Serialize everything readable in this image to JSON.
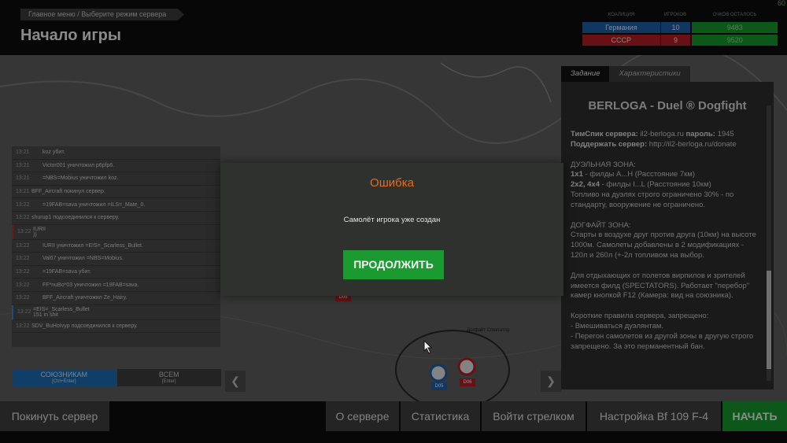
{
  "fps": "60",
  "breadcrumb": "Главное меню  / Выберите режим сервера",
  "page_title": "Начало игры",
  "scoreboard": {
    "headers": [
      "КОАЛИЦИЯ",
      "ИГРОКОВ",
      "ОЧКОВ ОСТАЛОСЬ"
    ],
    "rows": [
      {
        "coalition": "Германия",
        "players": "10",
        "points": "9483"
      },
      {
        "coalition": "СССР",
        "players": "9",
        "points": "9520"
      }
    ]
  },
  "chat": {
    "lines": [
      {
        "time": "13:21",
        "text": "koz убит."
      },
      {
        "time": "13:21",
        "text": "Victor001 уничтожил p6pfp6."
      },
      {
        "time": "13:21",
        "text": "=NBS=Mobius уничтожил koz."
      },
      {
        "time": "13:21",
        "text": "BFF_Aircraft покинул сервер."
      },
      {
        "time": "13:22",
        "text": "=19FAB=sava уничтожил =ILS=_Mate_0."
      },
      {
        "time": "13:22",
        "text": "shurup1 подсоединился к серверу."
      },
      {
        "time": "13:22",
        "text": "IURII\n))"
      },
      {
        "time": "13:22",
        "text": "IURII уничтожил =EIS=_Scarless_Bullet."
      },
      {
        "time": "13:22",
        "text": "Val67 уничтожил =NBS=Mobius."
      },
      {
        "time": "13:22",
        "text": "=19FAB=sava убит."
      },
      {
        "time": "13:22",
        "text": "FF*nuBo*03 уничтожил =19FAB=sava."
      },
      {
        "time": "13:22",
        "text": "BFF_Aircraft уничтожил Ze_Hairy."
      },
      {
        "time": "13:22",
        "text": "=EIS=_Scarless_Bullet\n151 in shit"
      },
      {
        "time": "13:22",
        "text": "SDV_BuHoIvyp подсоединился к серверу."
      }
    ],
    "tab_allies": "СОЮЗНИКАМ",
    "tab_allies_hint": "[Ctrl+Enter]",
    "tab_all": "ВСЕМ",
    "tab_all_hint": "[Enter]"
  },
  "brief": {
    "tab_mission": "Задание",
    "tab_specs": "Характеристики",
    "title": "BERLOGA - Duel ® Dogfight",
    "ts_label": "ТимСпик сервера:",
    "ts_value": "il2-berloga.ru",
    "pw_label": "пароль:",
    "pw_value": "1945",
    "support_label": "Поддержать сервер:",
    "support_value": "http://il2-berloga.ru/donate",
    "duel_head": "ДУЭЛЬНАЯ ЗОНА:",
    "duel_l1_b": "1x1",
    "duel_l1": " - филды А...Н (Расстояние 7км)",
    "duel_l2_b": "2x2, 4x4",
    "duel_l2": " - филды I...L (Расстояние 10км)",
    "duel_l3": "Топливо на дуэлях строго ограничено 30% - по стандарту, вооружение не ограничено.",
    "dog_head": "ДОГФАЙТ ЗОНА:",
    "dog_text": "Старты в воздухе друг против друга (10км) на высоте 1000м. Самолеты добавлены в 2 модификациях - 120л и 260л (+-2л топливом на выбор.",
    "spect_text": "Для отдыхающих от полетов вирпилов и зрителей имеется филд (SPECTATORS). Работает \"перебор\" камер кнопкой F12 (Камера: вид на союзника).",
    "rules_head": "Короткие правила сервера, запрещено:",
    "rule1": " - Вмешиваться дуэлянтам.",
    "rule2": " - Перегон самолетов из другой зоны в другую строго запрещено. За это перманентный бан."
  },
  "map": {
    "label_dogfight": "Догфайт Спектатор",
    "marker_a": "D05",
    "marker_b": "D06",
    "marker_c": "D05"
  },
  "bottom": {
    "leave": "Покинуть сервер",
    "about": "О сервере",
    "stats": "Статистика",
    "gunner": "Войти стрелком",
    "setup": "Настройка Bf 109 F-4",
    "start": "НАЧАТЬ"
  },
  "dialog": {
    "title": "Ошибка",
    "message": "Самолёт игрока уже создан",
    "continue": "ПРОДОЛЖИТЬ"
  },
  "colors": {
    "germany": "#1f5fa8",
    "ussr": "#b51e24",
    "green": "#1a9a31",
    "error_title": "#e96c1a"
  }
}
